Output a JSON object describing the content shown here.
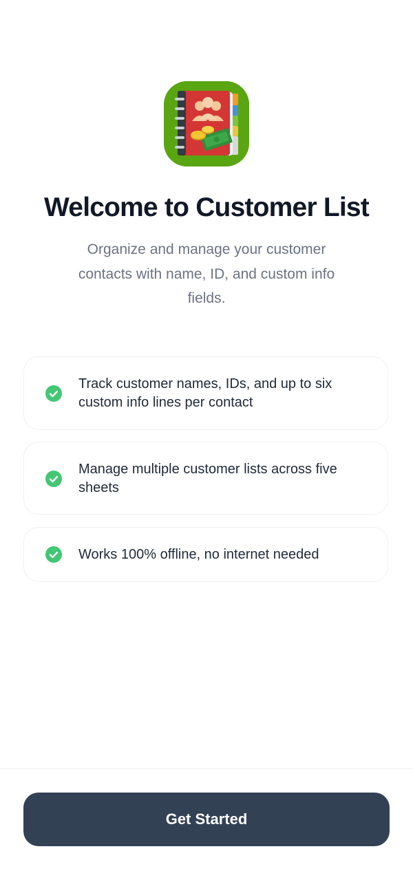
{
  "app": {
    "icon": "address-book-icon",
    "title": "Welcome to Customer List",
    "subtitle": "Organize and manage your customer contacts with name, ID, and custom info fields."
  },
  "features": [
    {
      "icon": "check-circle-icon",
      "text": "Track customer names, IDs, and up to six custom info lines per contact"
    },
    {
      "icon": "check-circle-icon",
      "text": "Manage multiple customer lists across five sheets"
    },
    {
      "icon": "check-circle-icon",
      "text": "Works 100% offline, no internet needed"
    }
  ],
  "actions": {
    "get_started_label": "Get Started"
  },
  "colors": {
    "icon_background": "#5aa512",
    "check": "#43c775",
    "button": "#334155",
    "title": "#111827",
    "subtitle": "#6b7280"
  }
}
